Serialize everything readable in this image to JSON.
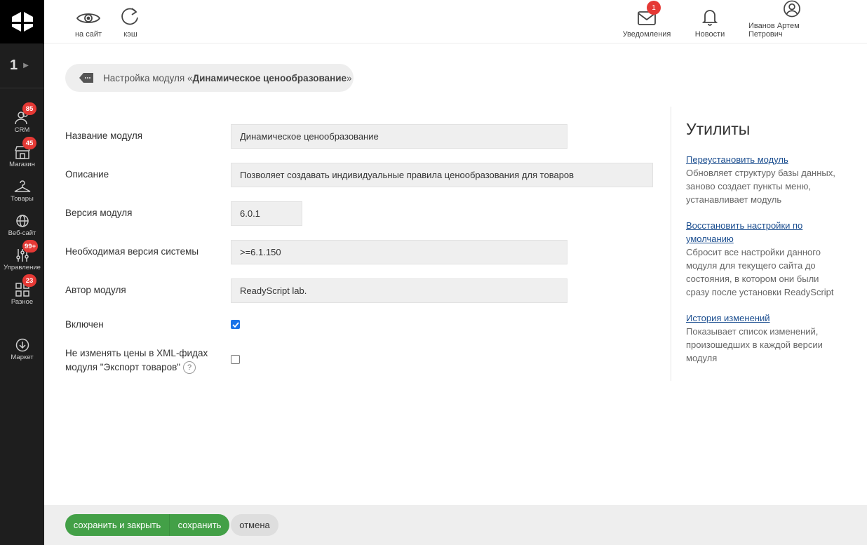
{
  "sidebar": {
    "site_number": "1",
    "items": [
      {
        "label": "CRM",
        "badge": "85"
      },
      {
        "label": "Магазин",
        "badge": "45"
      },
      {
        "label": "Товары",
        "badge": ""
      },
      {
        "label": "Веб-сайт",
        "badge": ""
      },
      {
        "label": "Управление",
        "badge": "99+"
      },
      {
        "label": "Разное",
        "badge": "23"
      },
      {
        "label": "Маркет",
        "badge": ""
      }
    ]
  },
  "header": {
    "to_site": "на сайт",
    "cache": "кэш",
    "notifications": "Уведомления",
    "notifications_badge": "1",
    "news": "Новости",
    "user": "Иванов Артем Петрович"
  },
  "title": {
    "prefix": "Настройка модуля «",
    "module": "Динамическое ценообразование",
    "suffix": "»"
  },
  "form": {
    "name_label": "Название модуля",
    "name_value": "Динамическое ценообразование",
    "description_label": "Описание",
    "description_value": "Позволяет создавать индивидуальные правила ценообразования для товаров",
    "version_label": "Версия модуля",
    "version_value": "6.0.1",
    "required_label": "Необходимая версия системы",
    "required_value": ">=6.1.150",
    "author_label": "Автор модуля",
    "author_value": "ReadyScript lab.",
    "enabled_label": "Включен",
    "enabled": true,
    "xml_label_line1": "Не изменять цены в XML-фидах",
    "xml_label_line2": "модуля \"Экспорт товаров\"",
    "help_glyph": "?",
    "xml_checked": false
  },
  "utils": {
    "title": "Утилиты",
    "items": [
      {
        "link": "Переустановить модуль",
        "desc": "Обновляет структуру базы данных, заново создает пункты меню, устанавливает модуль"
      },
      {
        "link": "Восстановить настройки по умолчанию",
        "desc": "Сбросит все настройки данного модуля для текущего сайта до состояния, в котором они были сразу после установки ReadyScript"
      },
      {
        "link": "История изменений",
        "desc": "Показывает список изменений, произошедших в каждой версии модуля"
      }
    ]
  },
  "footer": {
    "save_close": "сохранить и закрыть",
    "save": "сохранить",
    "cancel": "отмена"
  },
  "colors": {
    "sidebar_bg": "#1e1e1e",
    "accent_green": "#43a047",
    "badge_red": "#e53935",
    "link_blue": "#1a4d8f",
    "checkbox_blue": "#1a73e8"
  }
}
